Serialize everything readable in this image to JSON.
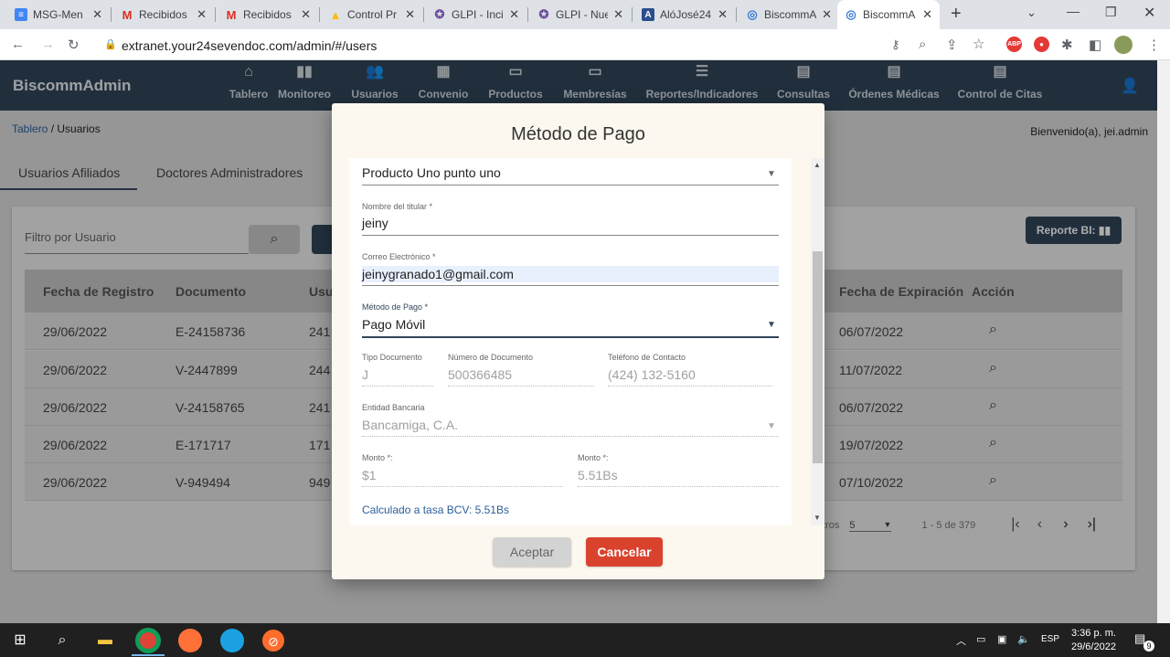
{
  "browser": {
    "tabs": [
      {
        "label": "MSG-Men",
        "icon": "docs-icon",
        "color": "#4285f4"
      },
      {
        "label": "Recibidos",
        "icon": "gmail-icon",
        "color": "#d93025"
      },
      {
        "label": "Recibidos",
        "icon": "gmail-icon",
        "color": "#d93025"
      },
      {
        "label": "Control Pr",
        "icon": "drive-icon",
        "color": "#fbbc04"
      },
      {
        "label": "GLPI - Incid",
        "icon": "glpi-icon",
        "color": "#6b4e9c"
      },
      {
        "label": "GLPI - Nue",
        "icon": "glpi-icon",
        "color": "#6b4e9c"
      },
      {
        "label": "AlóJosé24",
        "icon": "alojose-icon",
        "color": "#2b4e8c"
      },
      {
        "label": "BiscommA",
        "icon": "biscomm-icon",
        "color": "#3a7bd5"
      },
      {
        "label": "BiscommA",
        "icon": "biscomm-icon",
        "color": "#3a7bd5"
      }
    ],
    "url": "extranet.your24sevendoc.com/admin/#/users"
  },
  "app": {
    "brand": "BiscommAdmin",
    "nav": [
      {
        "label": "Tablero"
      },
      {
        "label": "Monitoreo"
      },
      {
        "label": "Usuarios"
      },
      {
        "label": "Convenio"
      },
      {
        "label": "Productos"
      },
      {
        "label": "Membresías"
      },
      {
        "label": "Reportes/Indicadores"
      },
      {
        "label": "Consultas"
      },
      {
        "label": "Órdenes Médicas"
      },
      {
        "label": "Control de Citas"
      }
    ],
    "breadcrumb": {
      "link": "Tablero",
      "current": " / Usuarios"
    },
    "welcome": "Bienvenido(a), jei.admin",
    "page_tabs": [
      "Usuarios Afiliados",
      "Doctores Administradores"
    ],
    "filter_placeholder": "Filtro por Usuario",
    "report_button": "Reporte BI:",
    "table": {
      "headers": [
        "Fecha de Registro",
        "Documento",
        "Usu",
        "Fecha de Expiración",
        "Acción"
      ],
      "rows": [
        [
          "29/06/2022",
          "E-24158736",
          "241",
          "06/07/2022"
        ],
        [
          "29/06/2022",
          "V-2447899",
          "244",
          "11/07/2022"
        ],
        [
          "29/06/2022",
          "V-24158765",
          "241",
          "06/07/2022"
        ],
        [
          "29/06/2022",
          "E-171717",
          "171",
          "19/07/2022"
        ],
        [
          "29/06/2022",
          "V-949494",
          "949",
          "07/10/2022"
        ]
      ]
    },
    "pager": {
      "per_page_label": "tros",
      "per_page": "5",
      "range": "1 - 5 de 379"
    }
  },
  "dialog": {
    "title": "Método de Pago",
    "product": "Producto Uno punto uno",
    "holder_label": "Nombre del titular *",
    "holder": "jeiny",
    "email_label": "Correo Electrónico *",
    "email": "jeinygranado1@gmail.com",
    "method_label": "Método de Pago *",
    "method": "Pago Móvil",
    "doc_type_label": "Tipo Documento",
    "doc_type": "J",
    "doc_number_label": "Número de Documento",
    "doc_number": "500366485",
    "phone_label": "Teléfono de Contacto",
    "phone": "(424) 132-5160",
    "bank_label": "Entidad Bancaria",
    "bank": "Bancamiga, C.A.",
    "amount_usd_label": "Monto *:",
    "amount_usd": "$1",
    "amount_bs_label": "Monto *:",
    "amount_bs": "5.51Bs",
    "rate_note": "Calculado a tasa BCV: 5.51Bs",
    "accept": "Aceptar",
    "cancel": "Cancelar"
  },
  "taskbar": {
    "lang": "ESP",
    "time": "3:36 p. m.",
    "date": "29/6/2022",
    "notif_count": "9"
  }
}
